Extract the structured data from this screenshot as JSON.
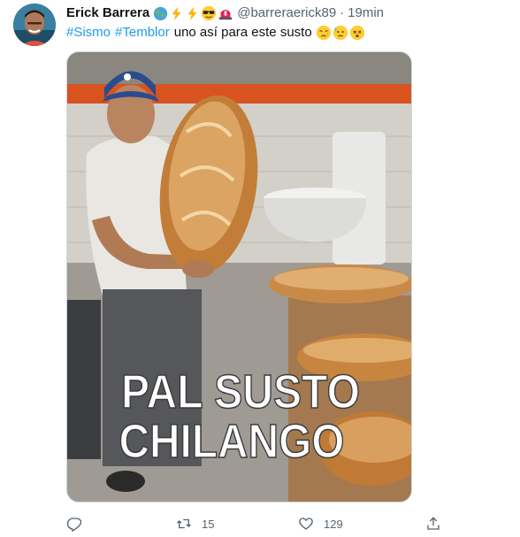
{
  "author": {
    "display_name": "Erick Barrera",
    "handle": "@barreraerick89",
    "name_emoji": [
      "globe-emoji",
      "lightning-emoji",
      "lightning-emoji",
      "sunglasses-emoji",
      "siren-emoji"
    ]
  },
  "timestamp": "19min",
  "separator": "·",
  "tweet": {
    "hashtags": [
      "#Sismo",
      "#Temblor"
    ],
    "text": "uno así para este susto",
    "emoji": [
      "sad-relieved-face-emoji",
      "anxious-sweat-face-emoji",
      "dizzy-face-emoji"
    ]
  },
  "media": {
    "caption_line1": "PAL SUSTO",
    "caption_line2": "CHILANGO"
  },
  "actions": {
    "reply_count": "",
    "retweet_count": "15",
    "like_count": "129"
  },
  "colors": {
    "link": "#1d9bf0",
    "secondary_text": "#536471",
    "primary_text": "#0f1419"
  }
}
